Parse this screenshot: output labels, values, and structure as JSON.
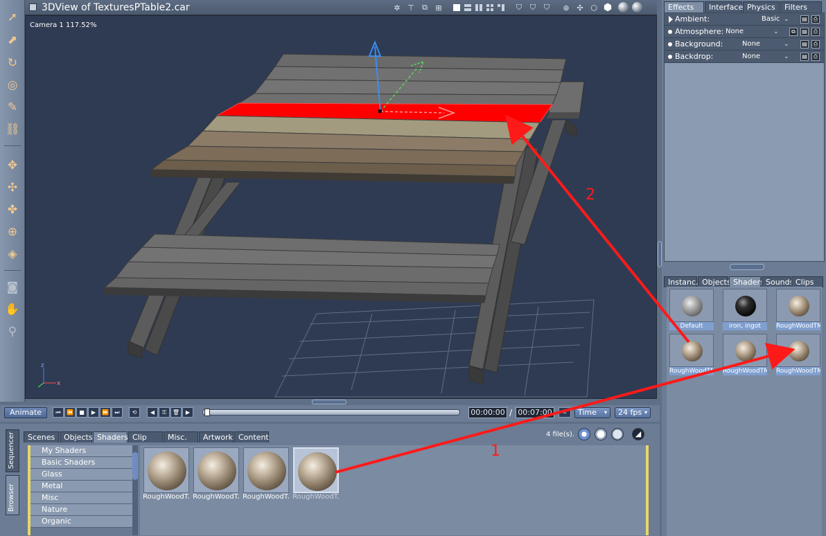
{
  "view": {
    "title": "3DView of TexturesPTable2.car",
    "camera_label": "Camera 1 117.52%",
    "axis_z": "z",
    "axis_x": "x"
  },
  "right_panel": {
    "top_tabs": [
      "Effects",
      "Interface",
      "Physics",
      "Filters"
    ],
    "effects": [
      {
        "label": "Ambient:",
        "value": "Basic"
      },
      {
        "label": "Atmosphere:",
        "value": "None"
      },
      {
        "label": "Background:",
        "value": "None"
      },
      {
        "label": "Backdrop:",
        "value": "None"
      }
    ],
    "bottom_tabs": [
      "Instanc.",
      "Objects",
      "Shaders",
      "Sounds",
      "Clips"
    ],
    "shaders": [
      {
        "name": "Default",
        "style": "metal"
      },
      {
        "name": "iron, ingot",
        "style": "iron"
      },
      {
        "name": "RoughWoodTM",
        "style": "wood"
      },
      {
        "name": "RoughWoodTM",
        "style": "wood"
      },
      {
        "name": "RoughWoodTM",
        "style": "wood"
      },
      {
        "name": "RoughWoodTM",
        "style": "wood"
      }
    ]
  },
  "timeline": {
    "animate_label": "Animate",
    "current_time": "00:00:00",
    "separator": "/",
    "end_time": "00:07:00",
    "time_mode": "Time",
    "fps": "24 fps"
  },
  "browser": {
    "side_tabs": [
      "Sequencer",
      "Browser"
    ],
    "tabs": [
      "Scenes",
      "Objects",
      "Shaders",
      "Clip",
      "Misc.",
      "Artwork",
      "Content"
    ],
    "active_tab": "Shaders",
    "file_count": "4 file(s).",
    "folders": [
      "My Shaders",
      "Basic Shaders",
      "Glass",
      "Metal",
      "Misc",
      "Nature",
      "Organic"
    ],
    "items": [
      "RoughWoodT.",
      "RoughWoodT.",
      "RoughWoodT.",
      "RoughWoodT."
    ]
  },
  "annotations": {
    "label_1": "1",
    "label_2": "2",
    "arrow_color": "#ff1a1a"
  },
  "colors": {
    "viewport_bg": "#2f3b52",
    "selected_plank": "#ff0000",
    "accent_tab": "#7e8fa6"
  }
}
